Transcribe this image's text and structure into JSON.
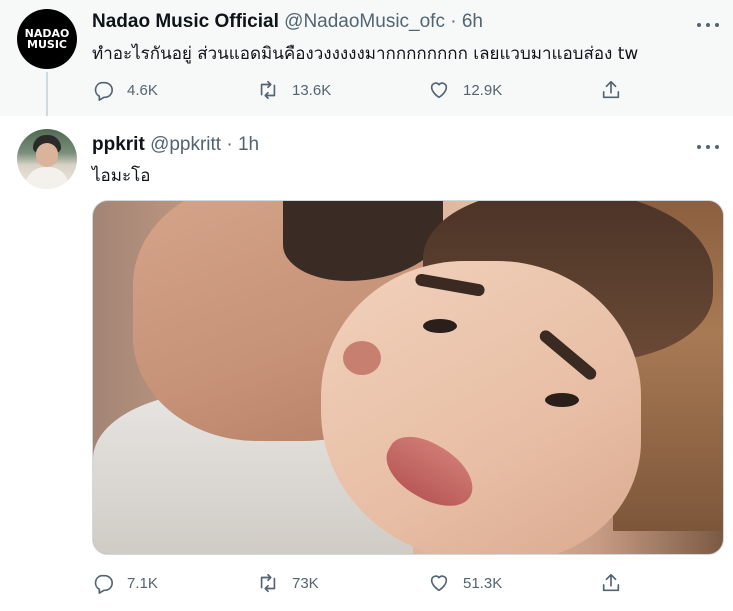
{
  "colors": {
    "secondary_text": "#536471",
    "primary_text": "#0f1419",
    "focused_bg": "#f7f9f9"
  },
  "tweets": [
    {
      "name": "Nadao Music Official",
      "handle": "@NadaoMusic_ofc",
      "separator": "·",
      "time": "6h",
      "avatar_line1": "NADAO",
      "avatar_line2": "MUSIC",
      "text": "ทำอะไรกันอยู่ ส่วนแอดมินคืองวงงงงงมากกกกกกกก เลยแวบมาแอบส่อง tw",
      "replies": "4.6K",
      "retweets": "13.6K",
      "likes": "12.9K",
      "icons": [
        "reply-icon",
        "retweet-icon",
        "like-icon",
        "share-icon",
        "more-icon"
      ]
    },
    {
      "name": "ppkrit",
      "handle": "@ppkritt",
      "separator": "·",
      "time": "1h",
      "text": "ไอมะโอ",
      "replies": "7.1K",
      "retweets": "73K",
      "likes": "51.3K",
      "icons": [
        "reply-icon",
        "retweet-icon",
        "like-icon",
        "share-icon",
        "more-icon"
      ]
    }
  ]
}
